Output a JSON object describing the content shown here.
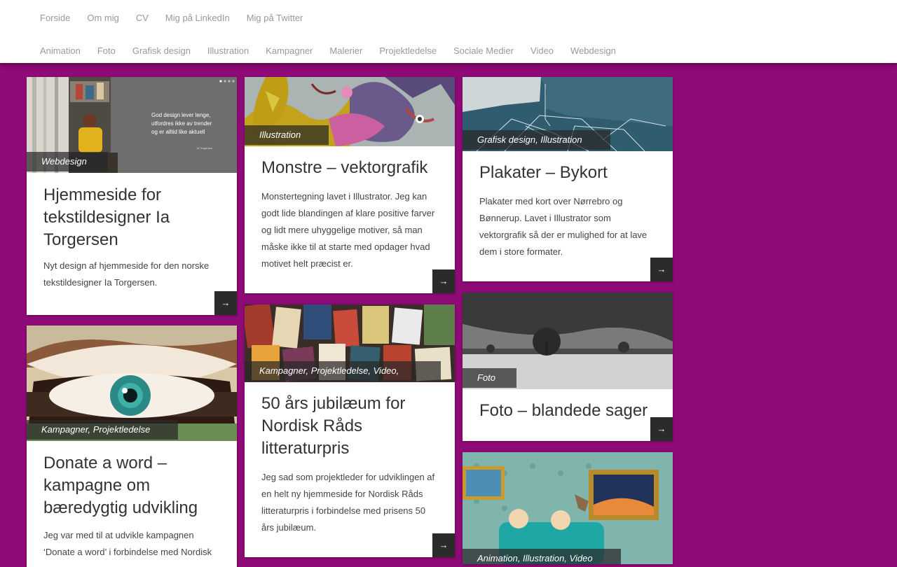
{
  "nav": {
    "primary": [
      "Forside",
      "Om mig",
      "CV",
      "Mig på LinkedIn",
      "Mig på Twitter"
    ],
    "categories": [
      "Animation",
      "Foto",
      "Grafisk design",
      "Illustration",
      "Kampagner",
      "Malerier",
      "Projektledelse",
      "Sociale Medier",
      "Video",
      "Webdesign"
    ]
  },
  "colors": {
    "background": "#8e0a76",
    "card": "#ffffff",
    "overlay": "#282828"
  },
  "arrow_label": "→",
  "posts": [
    {
      "id": "ia",
      "categories": [
        "Webdesign"
      ],
      "title": "Hjemmeside for tekstildesigner Ia Torgersen",
      "description": "Nyt design af hjemmeside for den norske tekstildesigner Ia Torgersen.",
      "slide_quote": "God design lever lenge, utfordres ikke av trender og er alltid like aktuell",
      "slide_author": "Ia Torgersen"
    },
    {
      "id": "monstre",
      "categories": [
        "Illustration"
      ],
      "title": "Monstre – vektorgrafik",
      "description": "Monstertegning lavet i Illustrator. Jeg kan godt lide blandingen af klare positive farver og lidt mere uhyggelige motiver, så man måske ikke til at starte med opdager hvad motivet helt præcist er."
    },
    {
      "id": "plakater",
      "categories": [
        "Grafisk design",
        "Illustration"
      ],
      "title": "Plakater – Bykort",
      "description": "Plakater med kort over Nørrebro og Bønnerup. Lavet i Illustrator som vektorgrafik så der er mulighed for at lave dem i store formater."
    },
    {
      "id": "donate",
      "categories": [
        "Kampagner",
        "Projektledelse"
      ],
      "title": "Donate a word – kampagne om bæredygtig udvikling",
      "description": "Jeg var med til at udvikle kampagnen ‘Donate a word’ i forbindelse med Nordisk"
    },
    {
      "id": "nordisk",
      "categories": [
        "Kampagner",
        "Projektledelse",
        "Video",
        ""
      ],
      "title": "50 års jubilæum for Nordisk Råds litteraturpris",
      "description": "Jeg sad som projektleder for udviklingen af en helt ny hjemmeside for Nordisk Råds litteraturpris i forbindelse med prisens 50 års jubilæum."
    },
    {
      "id": "foto",
      "categories": [
        "Foto"
      ],
      "title": "Foto – blandede sager",
      "description": ""
    },
    {
      "id": "animation",
      "categories": [
        "Animation",
        "Illustration",
        "Video"
      ],
      "title": "",
      "description": ""
    }
  ]
}
